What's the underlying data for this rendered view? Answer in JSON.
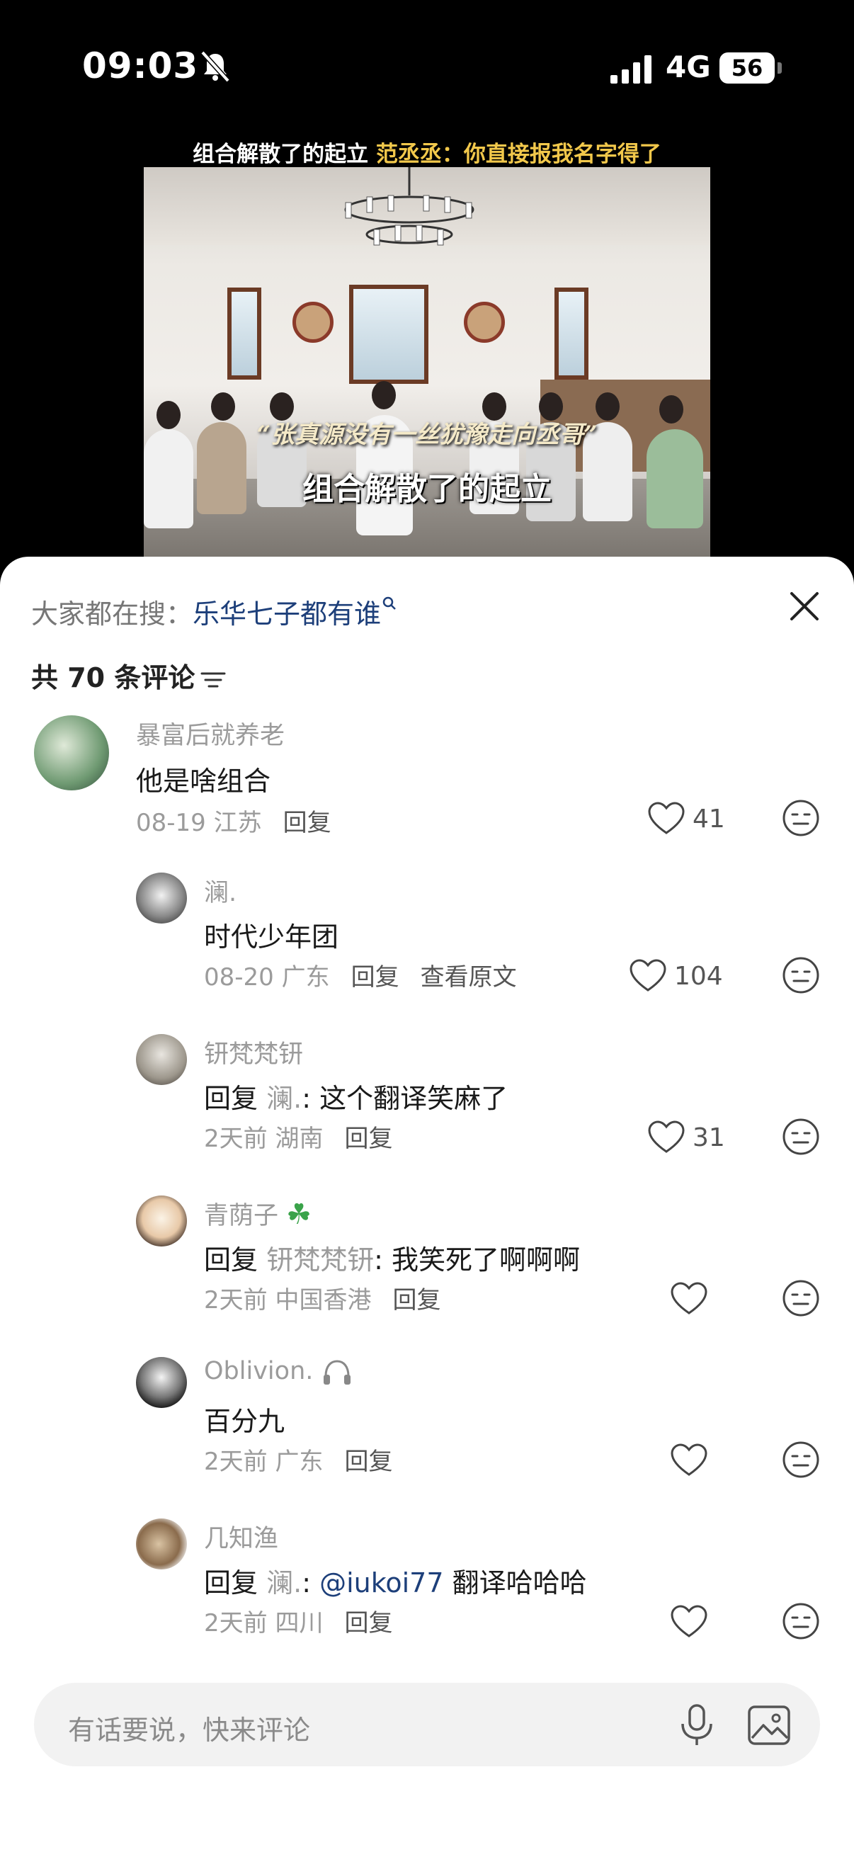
{
  "status_bar": {
    "time": "09:03",
    "network": "4G",
    "battery": "56"
  },
  "video": {
    "caption_white": "组合解散了的起立 ",
    "caption_highlight": "范丞丞：你直接报我名字得了",
    "subtitle_1": "“张真源没有一丝犹豫走向丞哥”",
    "subtitle_2": "组合解散了的起立"
  },
  "search": {
    "prefix": "大家都在搜：",
    "term": "乐华七子都有谁"
  },
  "comment_count": "共 70 条评论",
  "comments": [
    {
      "name": "暴富后就养老",
      "text": "他是啥组合",
      "date": "08-19",
      "location": "江苏",
      "reply": "回复",
      "likes": "41"
    },
    {
      "name": "澜.",
      "text": "时代少年团",
      "date": "08-20",
      "location": "广东",
      "reply": "回复",
      "extra": "查看原文",
      "likes": "104"
    },
    {
      "name": "钘梵梵钘",
      "reply_prefix": "回复 ",
      "reply_to": "澜.",
      "text": ": 这个翻译笑麻了",
      "date": "2天前",
      "location": "湖南",
      "reply": "回复",
      "likes": "31"
    },
    {
      "name": "青荫子",
      "reply_prefix": "回复 ",
      "reply_to": "钘梵梵钘",
      "text": ": 我笑死了啊啊啊",
      "date": "2天前",
      "location": "中国香港",
      "reply": "回复",
      "likes": ""
    },
    {
      "name": "Oblivion.",
      "text": "百分九",
      "date": "2天前",
      "location": "广东",
      "reply": "回复",
      "likes": ""
    },
    {
      "name": "几知渔",
      "reply_prefix": "回复 ",
      "reply_to": "澜.",
      "text_sep": ": ",
      "mention": "@iukoi77",
      "text": " 翻译哈哈哈",
      "date": "2天前",
      "location": "四川",
      "reply": "回复",
      "likes": ""
    }
  ],
  "input": {
    "placeholder": "有话要说，快来评论"
  },
  "colors": {
    "accent_link": "#1d3f7a",
    "muted": "#9b9b9b",
    "caption_highlight": "#f2c84b"
  }
}
